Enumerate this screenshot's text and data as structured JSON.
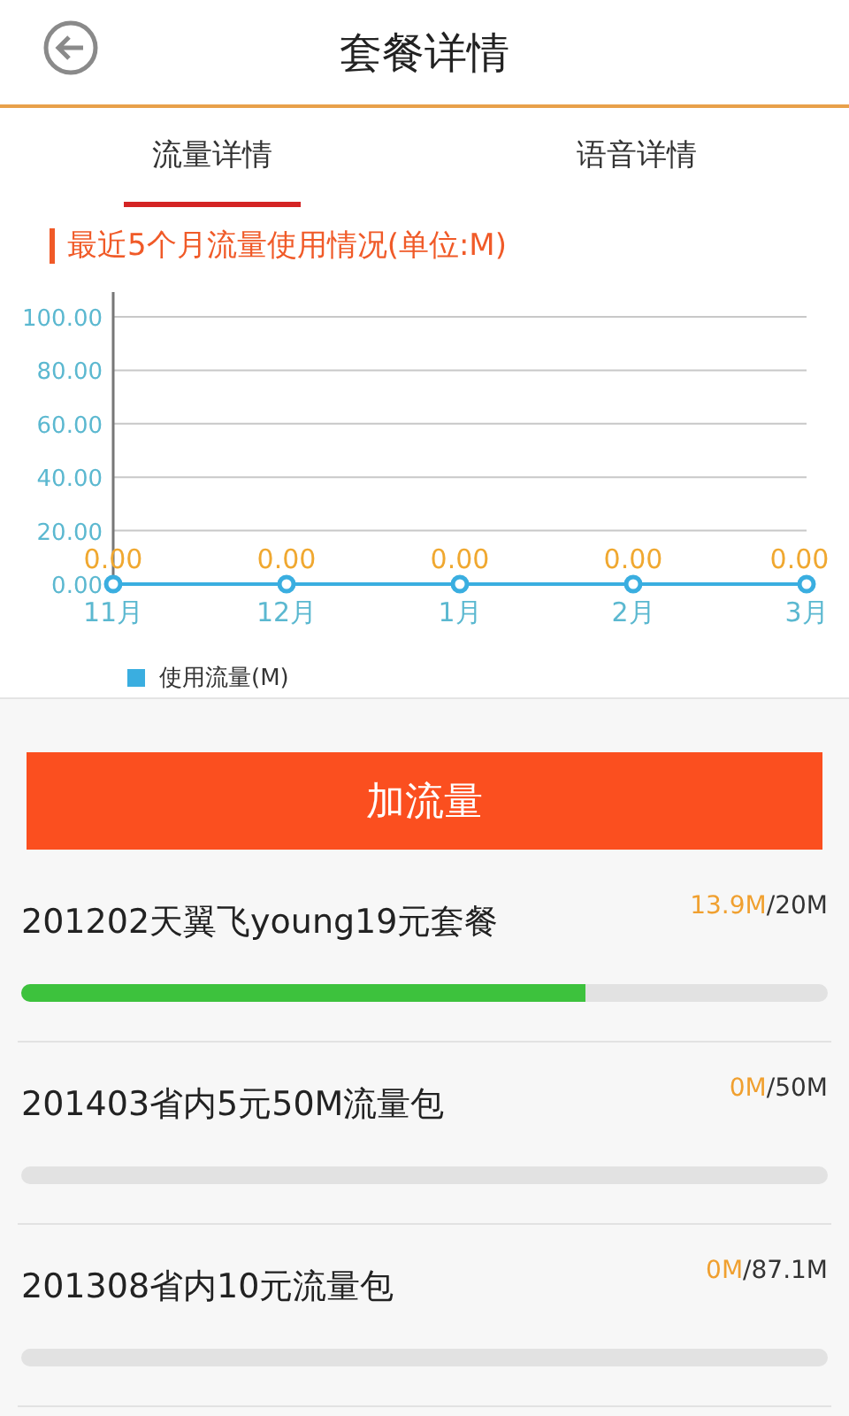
{
  "header": {
    "title": "套餐详情"
  },
  "tabs": [
    {
      "label": "流量详情",
      "selected": true
    },
    {
      "label": "语音详情",
      "selected": false
    }
  ],
  "section_title": "最近5个月流量使用情况(单位:M)",
  "chart_data": {
    "type": "line",
    "categories": [
      "11月",
      "12月",
      "1月",
      "2月",
      "3月"
    ],
    "series": [
      {
        "name": "使用流量(M)",
        "color": "#3aaee0",
        "marker": "circle",
        "values": [
          0,
          0,
          0,
          0,
          0
        ]
      }
    ],
    "ylim": [
      0,
      100
    ],
    "yticks": [
      {
        "value": 0,
        "label": "0.00"
      },
      {
        "value": 20,
        "label": "20.00"
      },
      {
        "value": 40,
        "label": "40.00"
      },
      {
        "value": 60,
        "label": "60.00"
      },
      {
        "value": 80,
        "label": "80.00"
      },
      {
        "value": 100,
        "label": "100.00"
      }
    ],
    "grid": true,
    "value_labels": [
      "0.00",
      "0.00",
      "0.00",
      "0.00",
      "0.00"
    ]
  },
  "add_button": "加流量",
  "packages": [
    {
      "name": "201202天翼飞young19元套餐",
      "used": "13.9M",
      "total": "/20M",
      "level": 0.7
    },
    {
      "name": "201403省内5元50M流量包",
      "used": "0M",
      "total": "/50M"
    },
    {
      "name": "201308省内10元流量包",
      "used": "0M",
      "total": "/87.1M"
    }
  ]
}
